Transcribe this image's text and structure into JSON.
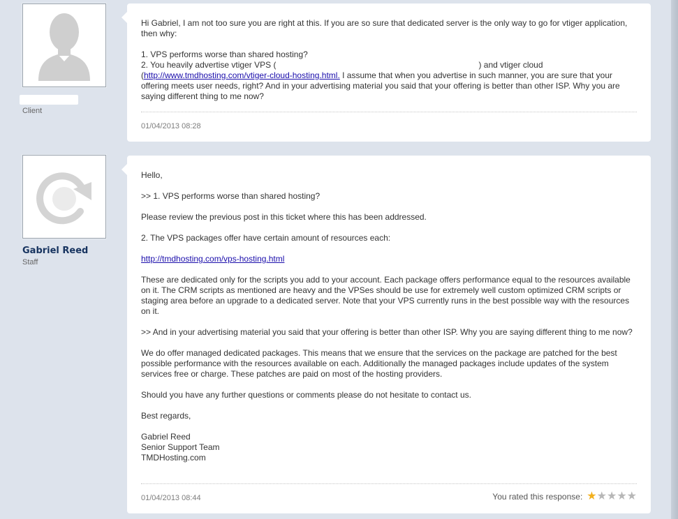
{
  "posts": [
    {
      "author_role": "Client",
      "messages": {
        "line1": "Hi Gabriel, I am not too sure you are right at this. If you are so sure that dedicated server is the only way to go for vtiger application, then why:",
        "line2": "1. VPS performs worse than shared hosting?",
        "line3a": "2. You heavily advertise vtiger VPS (",
        "line3b": ") and vtiger cloud",
        "line4_paren": "(",
        "link": "http://www.tmdhosting.com/vtiger-cloud-hosting.html.",
        "line4_rest": " I assume that when you advertise in such manner, you are sure that your offering meets user needs, right? And in your advertising material you said that your offering is better than other ISP. Why you are saying different thing to me now?"
      },
      "timestamp": "01/04/2013 08:28"
    },
    {
      "author_name": "Gabriel Reed",
      "author_role": "Staff",
      "messages": {
        "p1": "Hello,",
        "p2": ">> 1. VPS performs worse than shared hosting?",
        "p3": "Please review the previous post in this ticket where this has been addressed.",
        "p4": "2. The VPS packages offer have certain amount of resources each:",
        "link": "http://tmdhosting.com/vps-hosting.html",
        "p5": "These are dedicated only for the scripts you add to your account. Each package offers performance equal to the resources available on it. The CRM scripts as mentioned are heavy and the VPSes should be use for extremely well custom optimized CRM scripts or staging area before an upgrade to a dedicated server. Note that your VPS currently runs in the best possible way with the resources on it.",
        "p6": ">> And in your advertising material you said that your offering is better than other ISP. Why you are saying different thing to me now?",
        "p7": "We do offer managed dedicated packages. This means that we ensure that the services on the package are patched for the best possible performance with the resources available on each. Additionally the managed packages include updates of the system services free or charge. These patches are paid on most of the hosting providers.",
        "p8": "Should you have any further questions or comments please do not hesitate to contact us.",
        "p9": "Best regards,",
        "sig1": "Gabriel Reed",
        "sig2": "Senior Support Team",
        "sig3": "TMDHosting.com"
      },
      "timestamp": "01/04/2013 08:44",
      "rating": {
        "label": "You rated this response:",
        "value": 1,
        "max": 5
      }
    }
  ],
  "colors": {
    "background": "#dde3ec",
    "author_name": "#16335f",
    "link": "#1a0dab",
    "star_filled": "#f2b01e",
    "star_empty": "#b7b7b7"
  },
  "icons": {
    "client_avatar": "person-silhouette-icon",
    "staff_avatar": "refresh-arrow-icon",
    "star": "star-icon"
  }
}
